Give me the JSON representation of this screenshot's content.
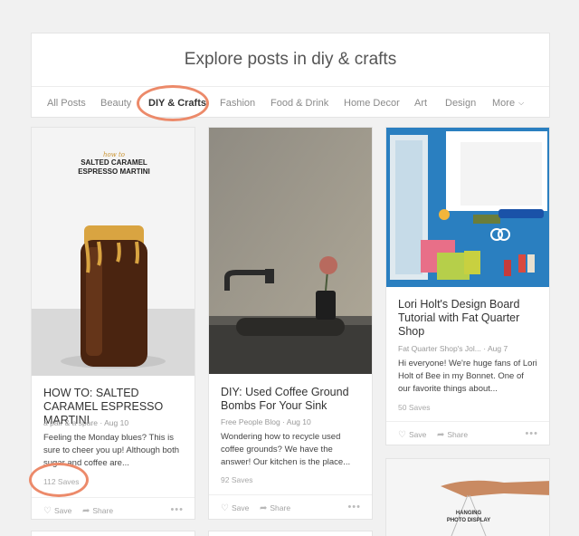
{
  "header": {
    "title": "Explore posts in diy & crafts"
  },
  "tabs": [
    {
      "label": "All Posts"
    },
    {
      "label": "Beauty"
    },
    {
      "label": "DIY & Crafts"
    },
    {
      "label": "Fashion"
    },
    {
      "label": "Food & Drink"
    },
    {
      "label": "Home Decor"
    },
    {
      "label": "Art"
    },
    {
      "label": "Design"
    },
    {
      "label": "More"
    }
  ],
  "cards": [
    {
      "image_text": {
        "script": "how to",
        "line1": "SALTED CARAMEL",
        "line2": "ESPRESSO MARTINI"
      },
      "title": "HOW TO: SALTED CARAMEL ESPRESSO MARTINI",
      "source": "a pair & a spare",
      "date": "Aug 10",
      "description": "Feeling the Monday blues? This is sure to cheer you up! Although both sugar and coffee are...",
      "saves": "112 Saves",
      "save_label": "Save",
      "share_label": "Share"
    },
    {
      "title": "DIY: Used Coffee Ground Bombs For Your Sink",
      "source": "Free People Blog",
      "date": "Aug 10",
      "description": "Wondering how to recycle used coffee grounds? We have the answer! Our kitchen is the place...",
      "saves": "92 Saves",
      "save_label": "Save",
      "share_label": "Share"
    },
    {
      "title": "Lori Holt's Design Board Tutorial with Fat Quarter Shop",
      "source": "Fat Quarter Shop's Jol...",
      "date": "Aug 7",
      "description": "Hi everyone! We're huge fans of Lori Holt of Bee in my Bonnet. One of our favorite things about...",
      "saves": "50 Saves",
      "save_label": "Save",
      "share_label": "Share"
    },
    {
      "image_text": {
        "line1": "HANGING",
        "line2": "PHOTO DISPLAY"
      }
    }
  ]
}
